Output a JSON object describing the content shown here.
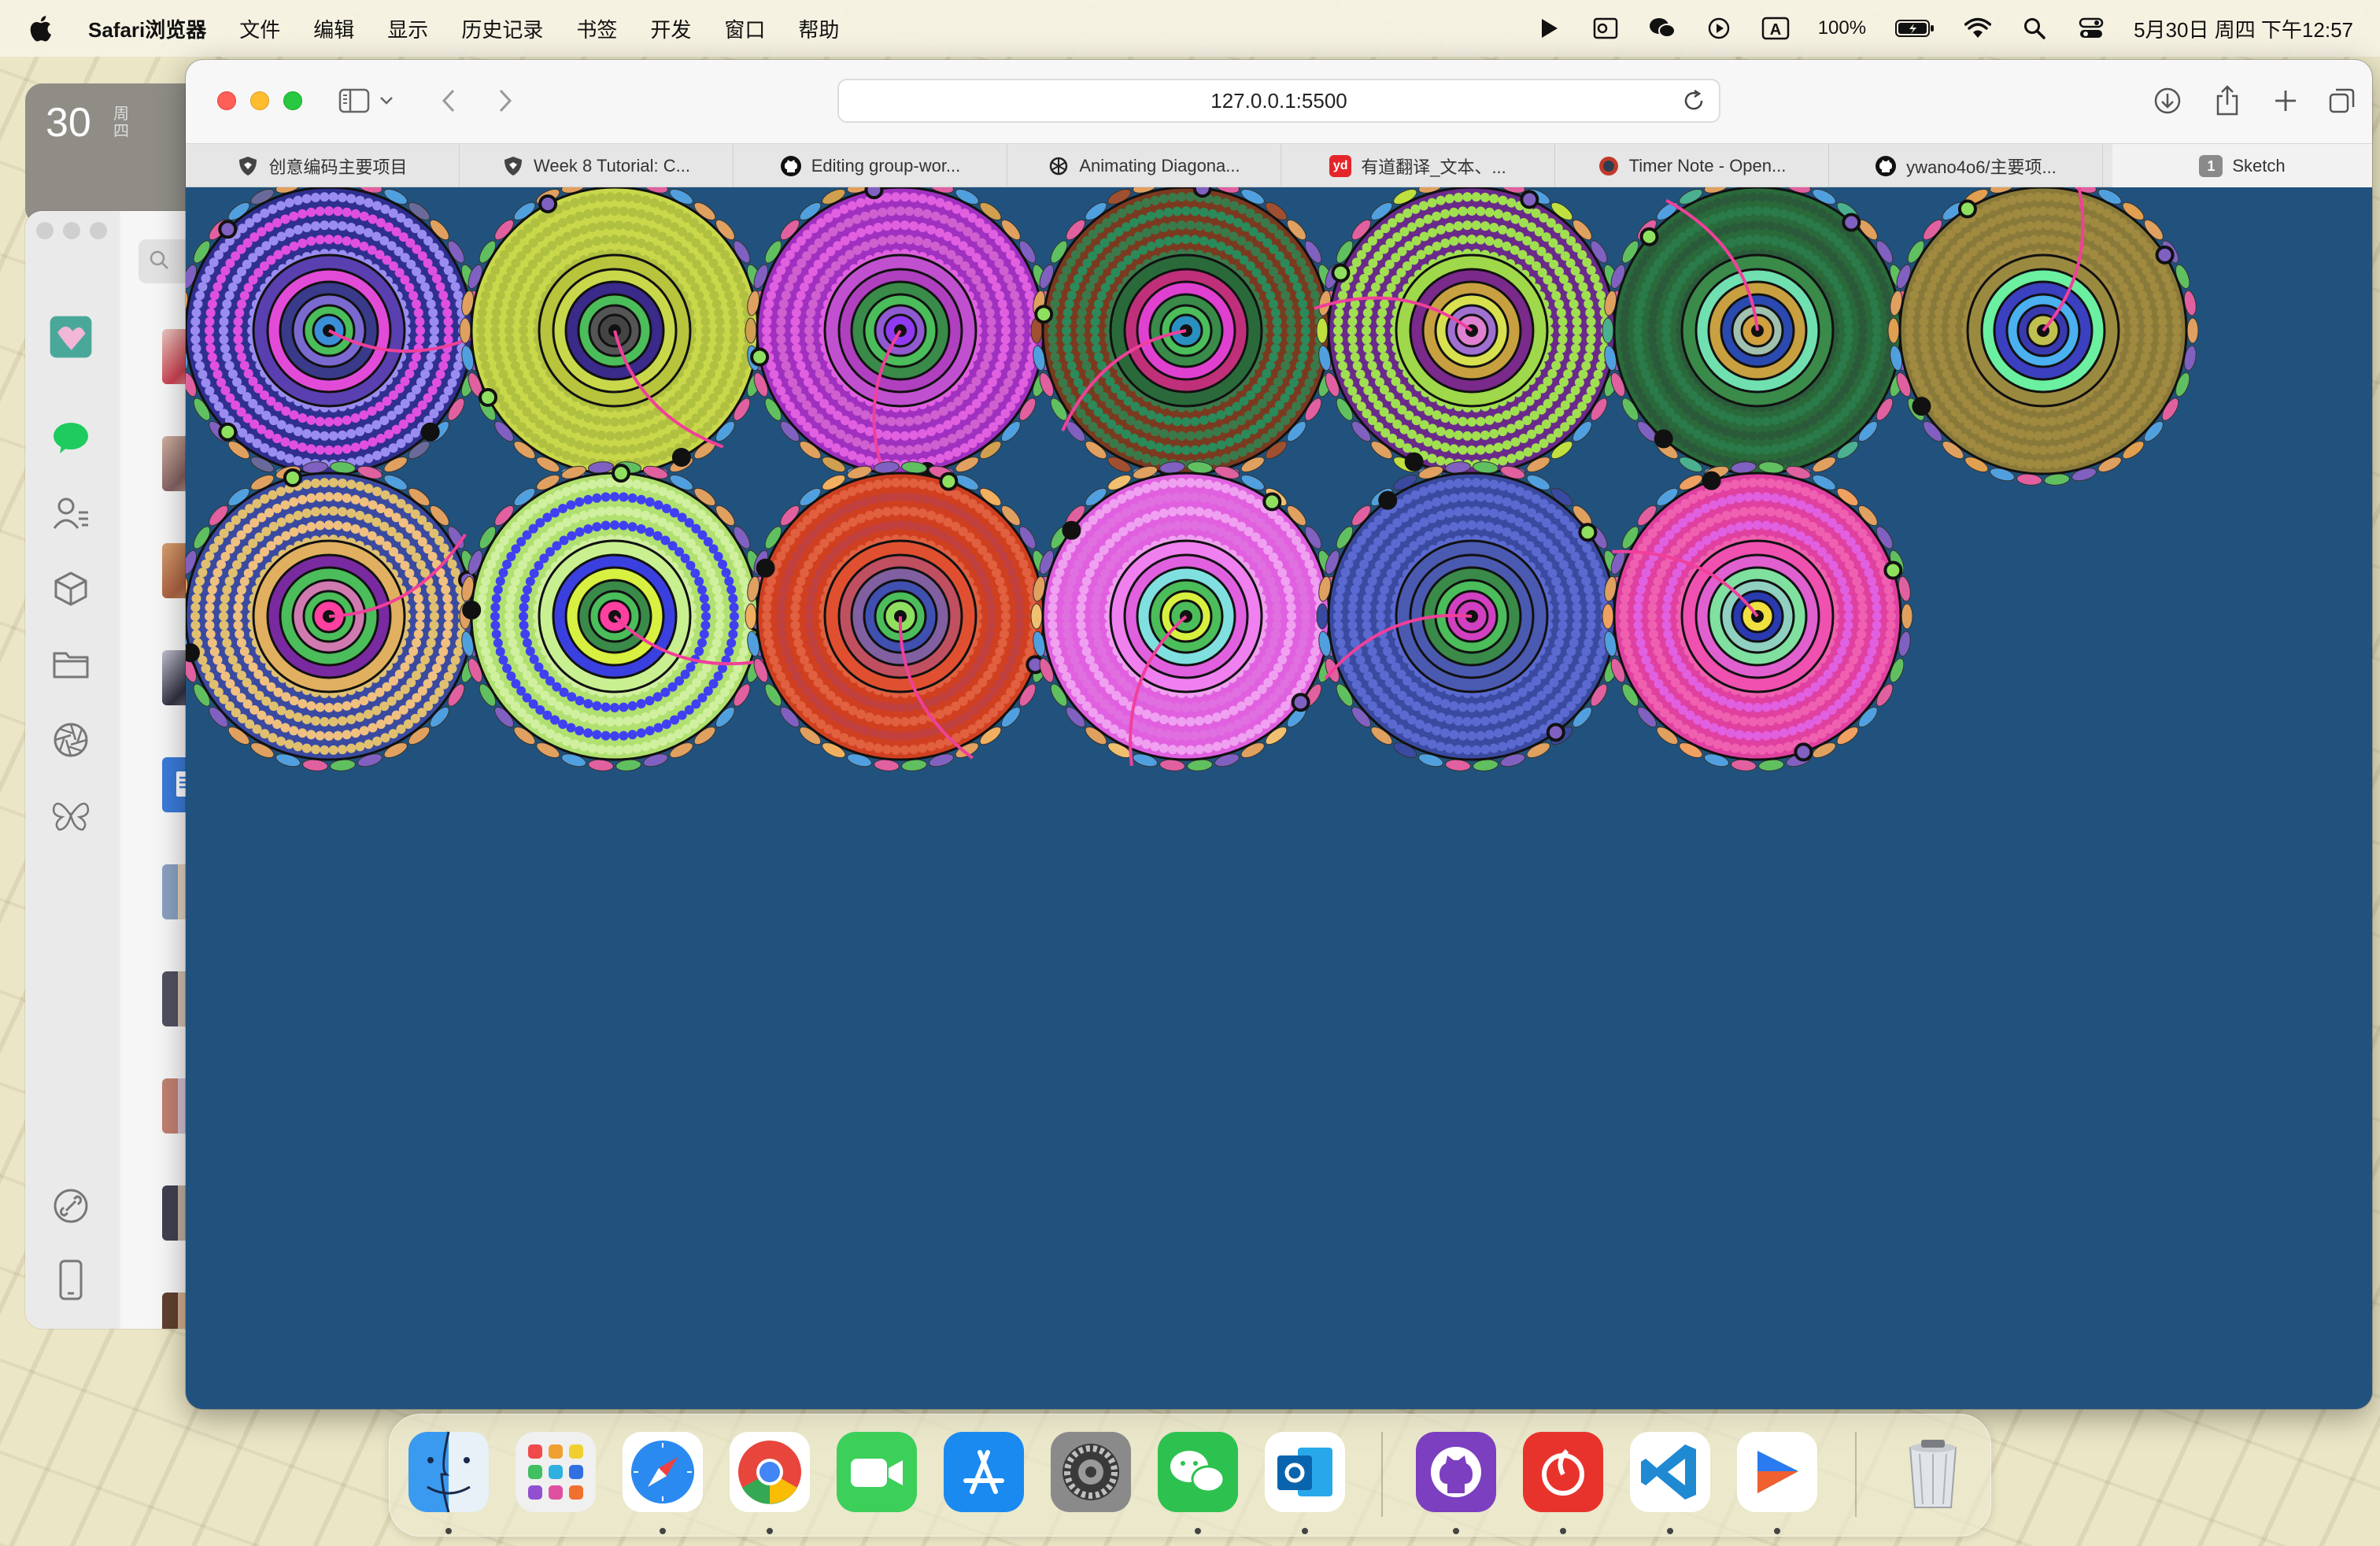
{
  "menubar": {
    "app_name": "Safari浏览器",
    "items": [
      "文件",
      "编辑",
      "显示",
      "历史记录",
      "书签",
      "开发",
      "窗口",
      "帮助"
    ],
    "input_method": "A",
    "battery": "100%",
    "clock": "5月30日 周四 下午12:57"
  },
  "background_app": {
    "date_number": "30",
    "date_weekday": "周四"
  },
  "safari": {
    "url": "127.0.0.1:5500",
    "tabs": [
      {
        "label": "创意编码主要项目",
        "favicon": "shield-icon",
        "color": "#444444"
      },
      {
        "label": "Week 8 Tutorial: C...",
        "favicon": "shield-icon",
        "color": "#444444"
      },
      {
        "label": "Editing group-wor...",
        "favicon": "github-icon",
        "color": "#111111"
      },
      {
        "label": "Animating Diagona...",
        "favicon": "openai-icon",
        "color": "#222222"
      },
      {
        "label": "有道翻译_文本、...",
        "favicon": "youdao-icon",
        "color": "#e4262b"
      },
      {
        "label": "Timer Note - Open...",
        "favicon": "timer-icon",
        "color": "#c0392b"
      },
      {
        "label": "ywano4o6/主要项...",
        "favicon": "github-icon",
        "color": "#111111"
      }
    ],
    "active_tab": {
      "label": "Sketch",
      "badge": "1"
    },
    "canvas_background": "#21527d"
  },
  "dock": {
    "apps": [
      {
        "name": "finder",
        "running": true
      },
      {
        "name": "launchpad",
        "running": false
      },
      {
        "name": "safari",
        "running": true
      },
      {
        "name": "chrome",
        "running": true
      },
      {
        "name": "facetime",
        "running": false
      },
      {
        "name": "app-store",
        "running": false
      },
      {
        "name": "system-settings",
        "running": false
      },
      {
        "name": "wechat",
        "running": true
      },
      {
        "name": "outlook",
        "running": true
      },
      {
        "name": "github-desktop",
        "running": true
      },
      {
        "name": "netease-music",
        "running": true
      },
      {
        "name": "vscode",
        "running": true
      },
      {
        "name": "feishu",
        "running": true
      },
      {
        "name": "trash",
        "running": false
      }
    ]
  },
  "artwork": {
    "circles": [
      {
        "rings": [
          "#2f2f8f",
          "#5a3fb0",
          "#e24bd8",
          "#3a3a8a",
          "#7a6ad0",
          "#4bbd5a",
          "#3a8fd8"
        ],
        "dots": "#9b8cf0",
        "dots2": "#e050e0",
        "outer": "#6a6a9a"
      },
      {
        "rings": [
          "#c9d84a",
          "#b7c43c",
          "#c9d84a",
          "#3a2a8a",
          "#4bbd5a",
          "#555555",
          "#444444"
        ],
        "dots": "#b0c040",
        "dots2": "#b0c040",
        "outer": "#e0a060"
      },
      {
        "rings": [
          "#a030c0",
          "#c050d0",
          "#b040c0",
          "#3a8a4a",
          "#4bbd5a",
          "#8f5ad0",
          "#8f3af0"
        ],
        "dots": "#e060e0",
        "dots2": "#d060d0",
        "outer": "#d0a050"
      },
      {
        "rings": [
          "#7a3a20",
          "#2a6a3a",
          "#c0307a",
          "#e040d0",
          "#3a8a4a",
          "#4bbd5a",
          "#2a90c0"
        ],
        "dots": "#3a7a4a",
        "dots2": "#2a8a5a",
        "outer": "#a05030"
      },
      {
        "rings": [
          "#6a2a8a",
          "#9fd84a",
          "#7a2a8a",
          "#c8a040",
          "#d8e050",
          "#a070d0",
          "#e080d0"
        ],
        "dots": "#a0e050",
        "dots2": "#a0e050",
        "outer": "#c0e040"
      },
      {
        "rings": [
          "#2a6a3a",
          "#3a8a4a",
          "#70e0b0",
          "#c8a040",
          "#2a4ab0",
          "#a0c0b0",
          "#d0a040"
        ],
        "dots": "#2a5a3a",
        "dots2": "#2a7a4a",
        "outer": "#4ab090"
      },
      {
        "rings": [
          "#8a7a3a",
          "#9a8a40",
          "#6af0a0",
          "#3a40c0",
          "#4ab0f0",
          "#3a3ab0",
          "#c0c050"
        ],
        "dots": "#a08a40",
        "dots2": "#a08a40",
        "outer": "#e0a050"
      },
      {
        "rings": [
          "#3a4aa0",
          "#e0b060",
          "#7a2aa0",
          "#4bbd5a",
          "#d07ab0",
          "#4bbd5a",
          "#ff40a0"
        ],
        "dots": "#e0c070",
        "dots2": "#f0c080",
        "outer": "#e0a060"
      },
      {
        "rings": [
          "#b0e070",
          "#c8f090",
          "#3a40e0",
          "#d8f040",
          "#3a8a4a",
          "#4bbd5a",
          "#ff40a0"
        ],
        "dots": "#d0f0a0",
        "dots2": "#4040f0",
        "outer": "#e0a060"
      },
      {
        "rings": [
          "#d04020",
          "#e05030",
          "#c05060",
          "#8060a0",
          "#4050b0",
          "#4bbd5a",
          "#90e060"
        ],
        "dots": "#e06040",
        "dots2": "#c04040",
        "outer": "#f0b060"
      },
      {
        "rings": [
          "#e060e0",
          "#f080f0",
          "#e060e0",
          "#80e0e0",
          "#4bbd5a",
          "#d8f040",
          "#4bbd5a"
        ],
        "dots": "#f0a0f0",
        "dots2": "#e070e0",
        "outer": "#f0c070"
      },
      {
        "rings": [
          "#3a4aa0",
          "#4a5ab0",
          "#4a5ab0",
          "#3a8a4a",
          "#4bbd5a",
          "#d040c0",
          "#d040c0"
        ],
        "dots": "#5a6ad0",
        "dots2": "#5a6ad0",
        "outer": "#3a4aa0"
      },
      {
        "rings": [
          "#e040a0",
          "#f050b0",
          "#e060d0",
          "#80e0a0",
          "#90d0c0",
          "#2a3ab0",
          "#f0e040"
        ],
        "dots": "#f060b0",
        "dots2": "#e060e0",
        "outer": "#f0a060"
      }
    ]
  }
}
